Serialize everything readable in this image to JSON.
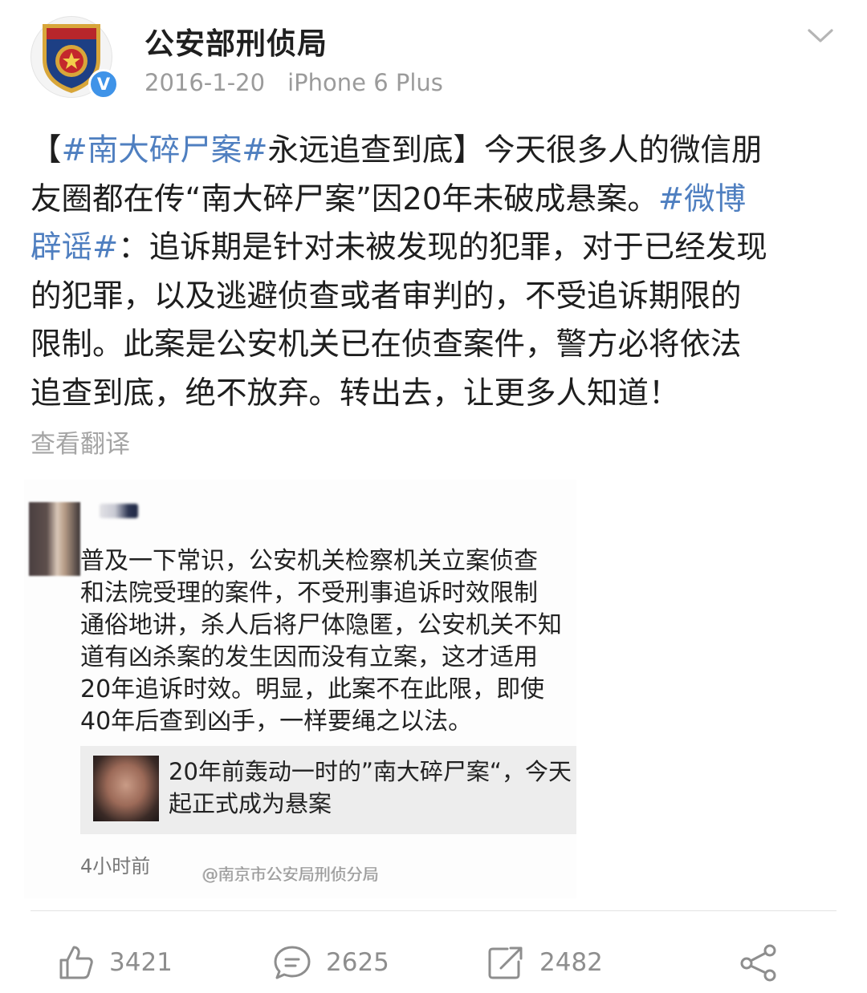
{
  "account": {
    "name": "公安部刑侦局",
    "date": "2016-1-20",
    "source": "iPhone 6 Plus",
    "verified_mark": "V"
  },
  "post": {
    "lines": [
      [
        {
          "t": "【",
          "tag": false
        },
        {
          "t": "#南大碎尸案#",
          "tag": true
        },
        {
          "t": "永远追查到底】今天很多人的微信朋",
          "tag": false
        }
      ],
      [
        {
          "t": "友圈都在传“南大碎尸案”因20年未破成悬案。",
          "tag": false
        },
        {
          "t": "#微博",
          "tag": true
        }
      ],
      [
        {
          "t": "辟谣#",
          "tag": true
        },
        {
          "t": "：追诉期是针对未被发现的犯罪，对于已经发现",
          "tag": false
        }
      ],
      [
        {
          "t": "的犯罪，以及逃避侦查或者审判的，不受追诉期限的",
          "tag": false
        }
      ],
      [
        {
          "t": "限制。此案是公安机关已在侦查案件，警方必将依法",
          "tag": false
        }
      ],
      [
        {
          "t": "追查到底，绝不放弃。转出去，让更多人知道！",
          "tag": false
        }
      ]
    ],
    "translate_label": "查看翻译"
  },
  "image": {
    "comment_lines": [
      "普及一下常识，公安机关检察机关立案侦查",
      "和法院受理的案件，不受刑事追诉时效限制",
      "通俗地讲，杀人后将尸体隐匿，公安机关不知",
      "道有凶杀案的发生因而没有立案，这才适用",
      "20年追诉时效。明显，此案不在此限，即使",
      "40年后查到凶手，一样要绳之以法。"
    ],
    "quoted_lines": [
      "20年前轰动一时的”南大碎尸案“，今天",
      "起正式成为悬案"
    ],
    "time": "4小时前",
    "watermark": "@南京市公安局刑侦分局"
  },
  "actions": {
    "like_count": "3421",
    "comment_count": "2625",
    "repost_count": "2482"
  },
  "colors": {
    "tag": "#4f7fc0",
    "verified": "#3f93e8",
    "muted": "#9b9b9b"
  },
  "icons": [
    "police-emblem-icon",
    "verified-icon",
    "chevron-down-icon",
    "like-icon",
    "comment-icon",
    "repost-icon",
    "share-icon"
  ]
}
